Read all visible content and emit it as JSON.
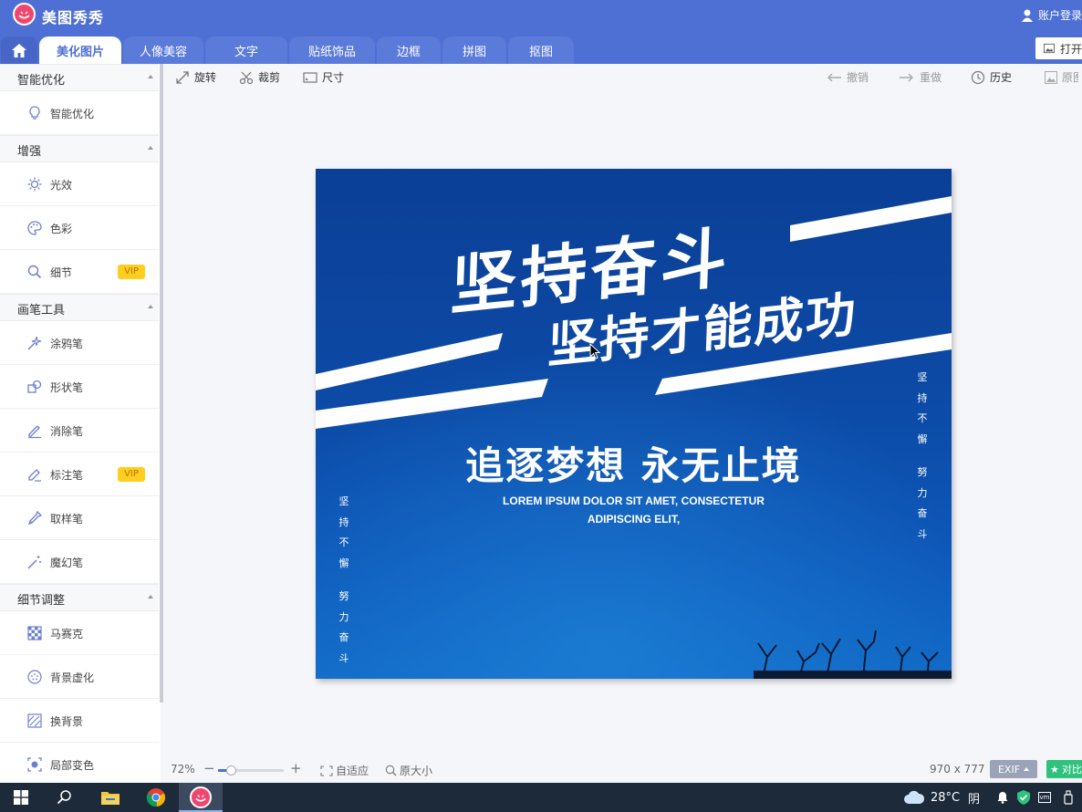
{
  "app": {
    "name": "美图秀秀",
    "account": "账户登录",
    "open_label": "打开"
  },
  "tabs": [
    {
      "label": "美化图片",
      "active": true
    },
    {
      "label": "人像美容"
    },
    {
      "label": "文字"
    },
    {
      "label": "贴纸饰品"
    },
    {
      "label": "边框"
    },
    {
      "label": "拼图"
    },
    {
      "label": "抠图"
    }
  ],
  "sidebar": {
    "sections": [
      {
        "title": "智能优化",
        "items": [
          {
            "label": "智能优化",
            "icon": "bulb-icon"
          }
        ]
      },
      {
        "title": "增强",
        "items": [
          {
            "label": "光效",
            "icon": "sun-icon"
          },
          {
            "label": "色彩",
            "icon": "palette-icon"
          },
          {
            "label": "细节",
            "icon": "magnifier-icon",
            "badge": "VIP"
          }
        ]
      },
      {
        "title": "画笔工具",
        "items": [
          {
            "label": "涂鸦笔",
            "icon": "sparkle-brush-icon"
          },
          {
            "label": "形状笔",
            "icon": "shapes-icon"
          },
          {
            "label": "消除笔",
            "icon": "eraser-pen-icon"
          },
          {
            "label": "标注笔",
            "icon": "pen-icon",
            "badge": "VIP"
          },
          {
            "label": "取样笔",
            "icon": "eyedropper-icon"
          },
          {
            "label": "魔幻笔",
            "icon": "magic-wand-icon"
          }
        ]
      },
      {
        "title": "细节调整",
        "items": [
          {
            "label": "马赛克",
            "icon": "mosaic-icon"
          },
          {
            "label": "背景虚化",
            "icon": "blur-icon"
          },
          {
            "label": "换背景",
            "icon": "replace-bg-icon"
          },
          {
            "label": "局部变色",
            "icon": "local-color-icon"
          }
        ]
      }
    ]
  },
  "toolbar": {
    "rotate": "旋转",
    "crop": "裁剪",
    "size": "尺寸",
    "undo": "撤销",
    "redo": "重做",
    "history": "历史",
    "original": "原图"
  },
  "image": {
    "headline1": "坚持奋斗",
    "headline2": "坚持才能成功",
    "subtitle": "追逐梦想 永无止境",
    "lorem1": "LOREM IPSUM DOLOR SIT AMET, CONSECTETUR",
    "lorem2": "ADIPISCING ELIT,",
    "side_chars": [
      "坚",
      "持",
      "不",
      "懈",
      "努",
      "力",
      "奋",
      "斗"
    ]
  },
  "status": {
    "zoom": "72%",
    "fit": "自适应",
    "actual": "原大小",
    "dimensions": "970 x 777",
    "exif": "EXIF",
    "compare": "对比"
  },
  "taskbar": {
    "temperature": "28°C",
    "weather": "阴"
  },
  "colors": {
    "accent": "#4e6fd4",
    "vip": "#ffce1f",
    "compare": "#2ec27e",
    "poster_blue": "#0c4aa6"
  }
}
